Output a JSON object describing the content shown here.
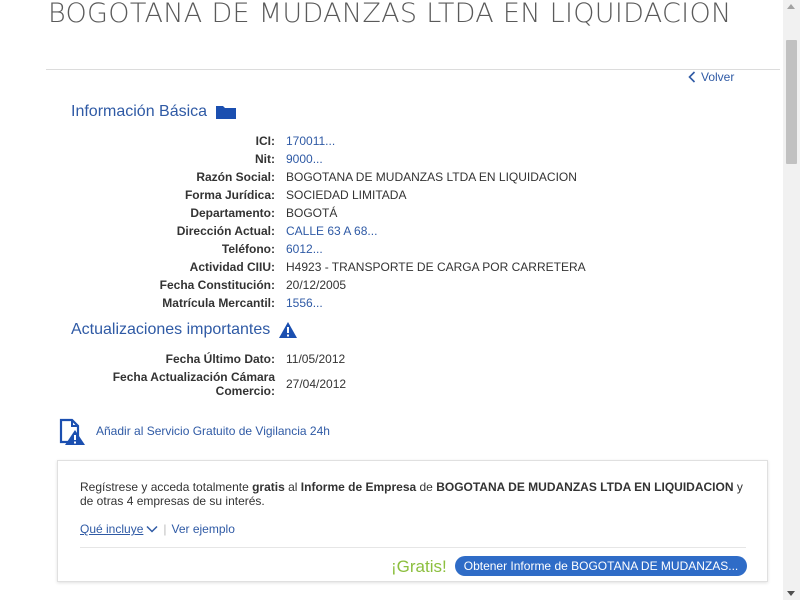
{
  "page": {
    "title": "BOGOTANA DE MUDANZAS LTDA EN LIQUIDACION",
    "back_label": "Volver"
  },
  "basic_info": {
    "heading": "Información Básica",
    "icon": "folder-icon",
    "rows": [
      {
        "label": "ICI:",
        "value": "170011..."
      },
      {
        "label": "Nit:",
        "value": "9000..."
      },
      {
        "label": "Razón Social:",
        "value": "BOGOTANA DE MUDANZAS LTDA EN LIQUIDACION"
      },
      {
        "label": "Forma Jurídica:",
        "value": "SOCIEDAD LIMITADA"
      },
      {
        "label": "Departamento:",
        "value": "BOGOTÁ"
      },
      {
        "label": "Dirección Actual:",
        "value": "CALLE 63 A 68..."
      },
      {
        "label": "Teléfono:",
        "value": "6012..."
      },
      {
        "label": "Actividad CIIU:",
        "value": "H4923 - TRANSPORTE DE CARGA POR CARRETERA"
      },
      {
        "label": "Fecha Constitución:",
        "value": "20/12/2005"
      },
      {
        "label": "Matrícula Mercantil:",
        "value": "1556..."
      }
    ]
  },
  "updates": {
    "heading": "Actualizaciones importantes",
    "icon": "warning-icon",
    "rows": [
      {
        "label": "Fecha Último Dato:",
        "value": "11/05/2012"
      },
      {
        "label_line1": "Fecha Actualización Cámara",
        "label_line2": "Comercio:",
        "value": "27/04/2012"
      }
    ]
  },
  "vigilancia": {
    "label": "Añadir al Servicio Gratuito de Vigilancia 24h",
    "icon": "document-alert-icon"
  },
  "promo": {
    "text_1": "Regístrese y acceda totalmente ",
    "text_bold_1": "gratis",
    "text_2": " al ",
    "text_bold_2": "Informe de Empresa",
    "text_3": " de ",
    "text_bold_3": "BOGOTANA DE MUDANZAS LTDA EN LIQUIDACION",
    "text_4": " y de otras 4 empresas de su interés.",
    "what_includes": "Qué incluye",
    "see_example": "Ver ejemplo",
    "gratis_label": "¡Gratis!",
    "cta_label": "Obtener Informe de BOGOTANA DE MUDANZAS..."
  },
  "colors": {
    "link": "#2f5aa5",
    "accent_green": "#8cbf3f",
    "button": "#2f6cc7"
  }
}
